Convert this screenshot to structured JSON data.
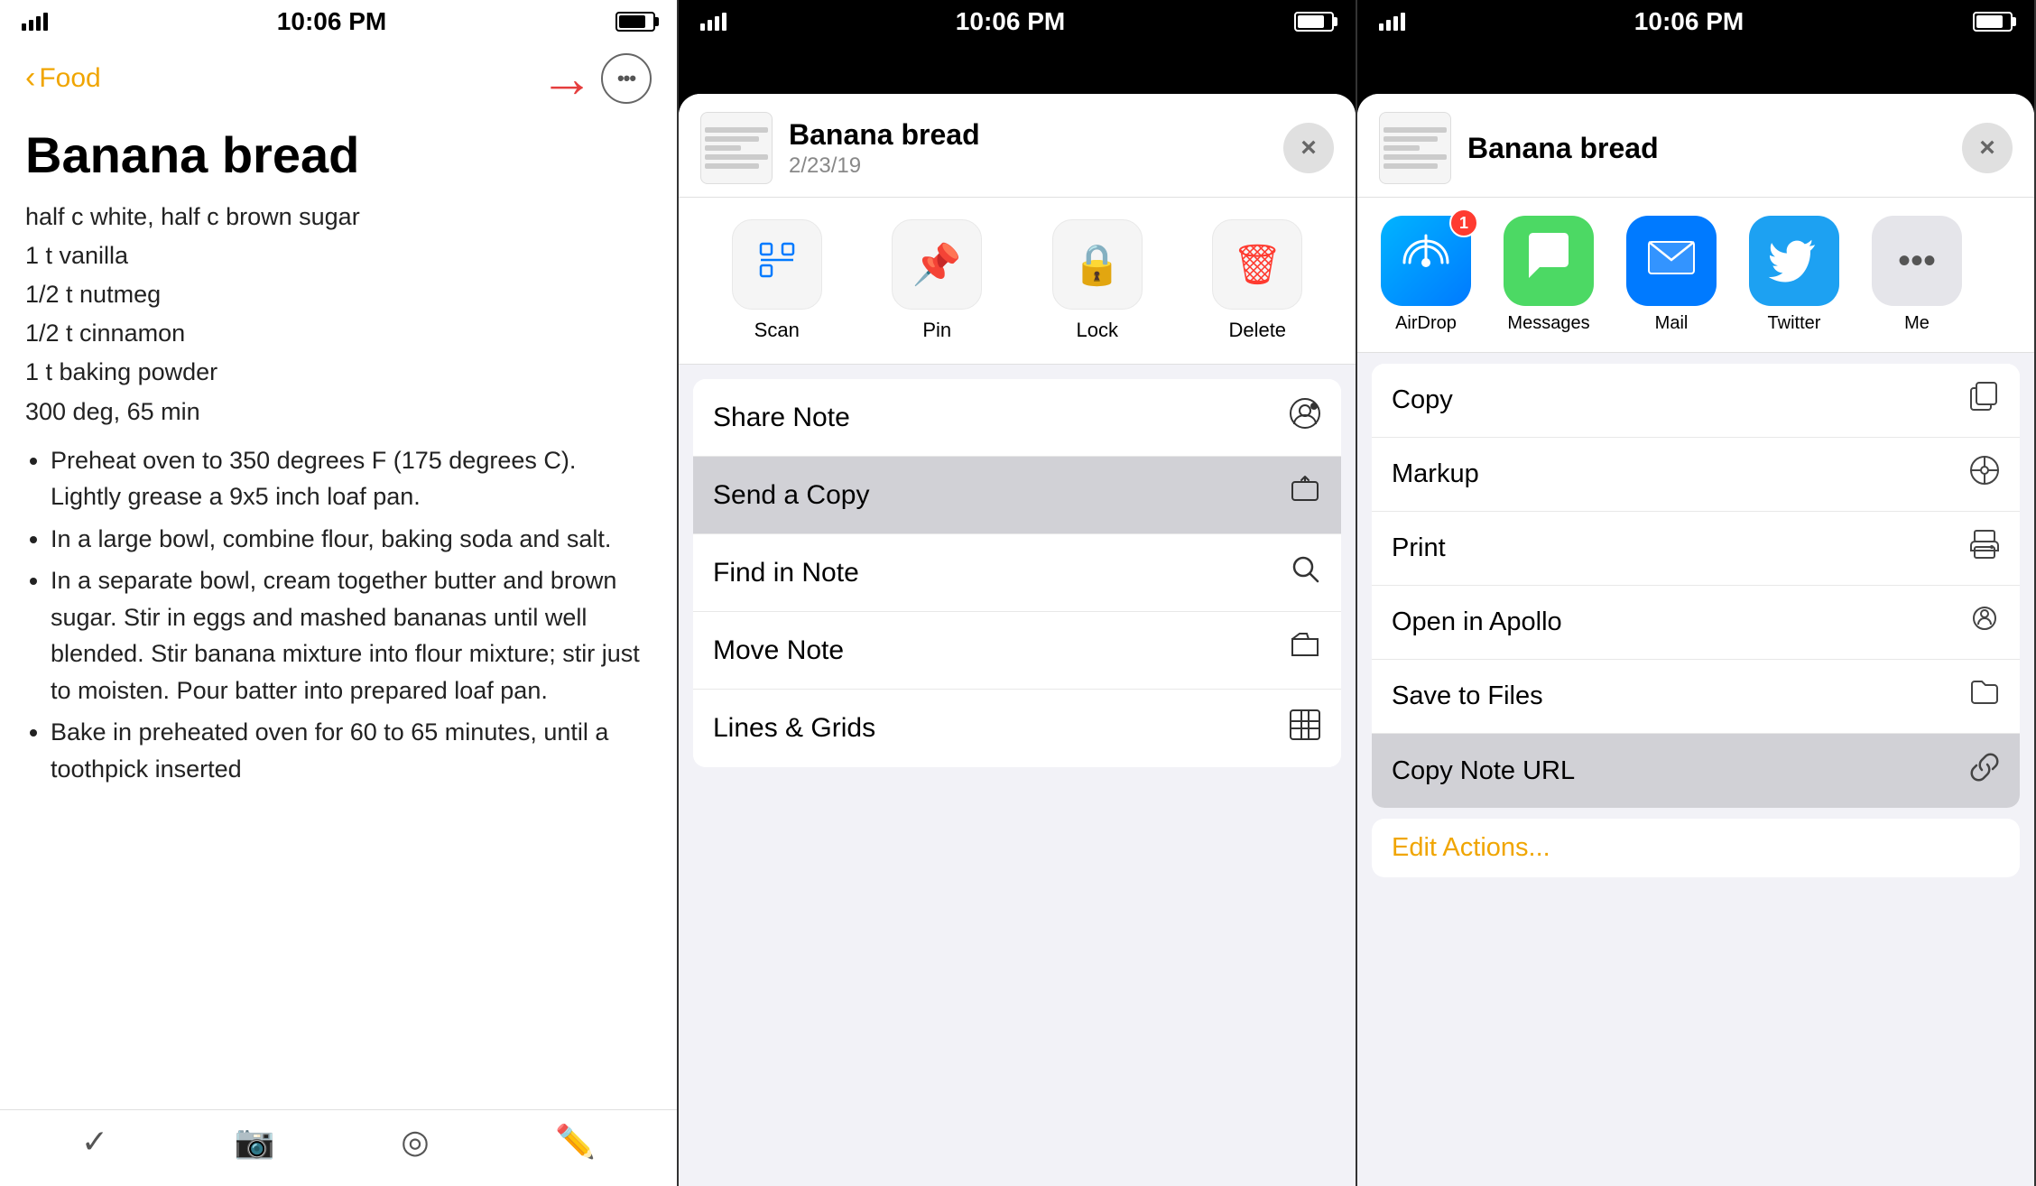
{
  "phone1": {
    "status": {
      "time": "10:06 PM"
    },
    "nav": {
      "back_label": "Food",
      "more_icon": "•••"
    },
    "note": {
      "title": "Banana bread",
      "body_lines": [
        "half c white, half c brown sugar",
        "1 t vanilla",
        "1/2 t nutmeg",
        "1/2 t cinnamon",
        "1 t baking powder",
        "300 deg, 65 min"
      ],
      "bullets": [
        "Preheat oven to 350 degrees F (175 degrees C). Lightly grease a 9x5 inch loaf pan.",
        "In a large bowl, combine flour, baking soda and salt.",
        "In a separate bowl, cream together butter and brown sugar. Stir in eggs and mashed bananas until well blended. Stir banana mixture into flour mixture; stir just to moisten. Pour batter into prepared loaf pan.",
        "Bake in preheated oven for 60 to 65 minutes, until a toothpick inserted"
      ]
    }
  },
  "phone2": {
    "status": {
      "time": "10:06 PM"
    },
    "sheet": {
      "title": "Banana bread",
      "date": "2/23/19",
      "close_label": "×"
    },
    "actions": [
      {
        "icon": "scan",
        "label": "Scan",
        "color": "#007AFF"
      },
      {
        "icon": "pin",
        "label": "Pin",
        "color": "#f5821f"
      },
      {
        "icon": "lock",
        "label": "Lock",
        "color": "#5856D6"
      },
      {
        "icon": "delete",
        "label": "Delete",
        "color": "#ff3b30"
      }
    ],
    "menu": [
      {
        "label": "Share Note",
        "icon": "person-share"
      },
      {
        "label": "Send a Copy",
        "icon": "share-box",
        "highlighted": true
      },
      {
        "label": "Find in Note",
        "icon": "search"
      },
      {
        "label": "Move Note",
        "icon": "folder"
      },
      {
        "label": "Lines & Grids",
        "icon": "grid"
      }
    ]
  },
  "phone3": {
    "status": {
      "time": "10:06 PM"
    },
    "sheet": {
      "title": "Banana bread",
      "close_label": "×"
    },
    "apps": [
      {
        "name": "AirDrop",
        "badge": "1"
      },
      {
        "name": "Messages",
        "badge": null
      },
      {
        "name": "Mail",
        "badge": null
      },
      {
        "name": "Twitter",
        "badge": null
      },
      {
        "name": "Me",
        "badge": null
      }
    ],
    "actions": [
      {
        "label": "Copy",
        "highlighted": false
      },
      {
        "label": "Markup",
        "highlighted": false
      },
      {
        "label": "Print",
        "highlighted": false
      },
      {
        "label": "Open in Apollo",
        "highlighted": false
      },
      {
        "label": "Save to Files",
        "highlighted": false
      },
      {
        "label": "Copy Note URL",
        "highlighted": true
      }
    ],
    "edit_actions": "Edit Actions..."
  }
}
